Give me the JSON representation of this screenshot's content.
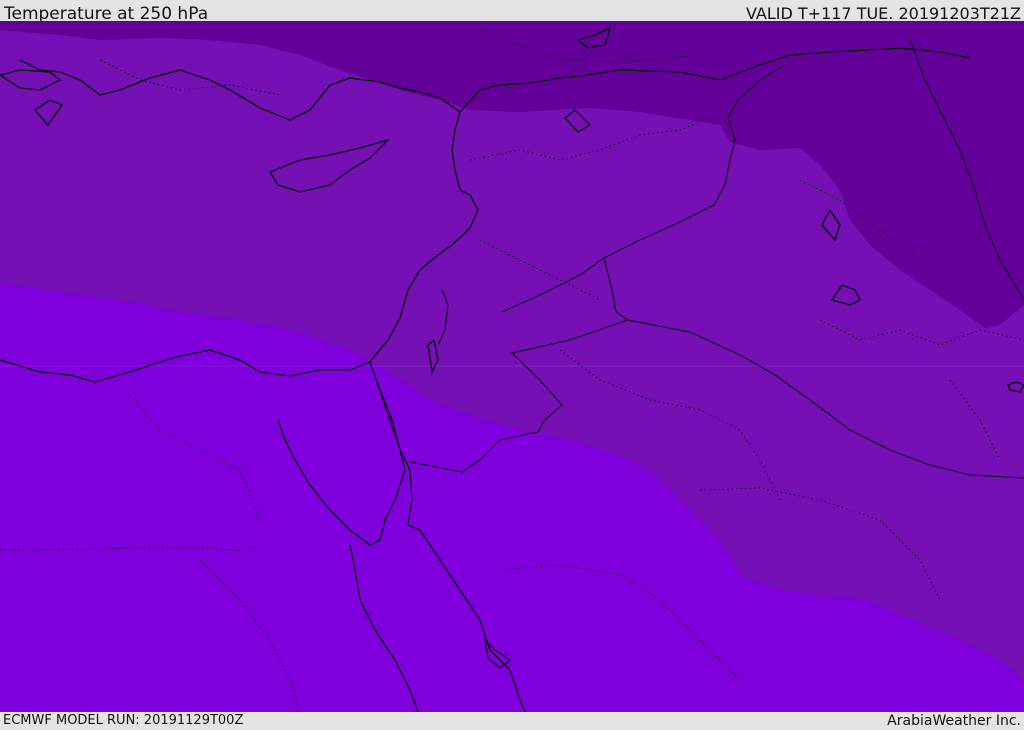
{
  "header": {
    "title": "Temperature at 250 hPa",
    "valid_time": "VALID T+117 TUE. 20191203T21Z"
  },
  "footer": {
    "model_run": "ECMWF MODEL RUN: 20191129T00Z",
    "credit": "ArabiaWeather Inc."
  },
  "colors": {
    "band_warm": "#7f00dc",
    "band_mid": "#7511b4",
    "band_cold": "#63009a",
    "coastline": "#000000",
    "bar_background": "#e4e4e4"
  }
}
